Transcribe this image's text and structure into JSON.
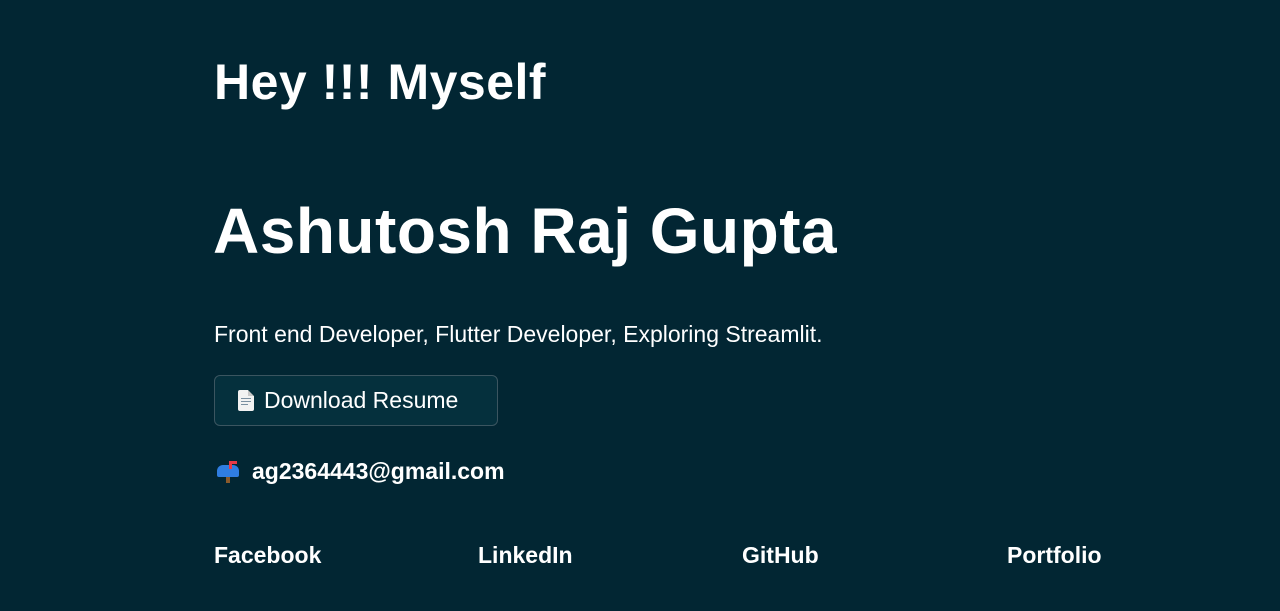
{
  "header": {
    "greeting": "Hey !!! Myself",
    "name": "Ashutosh Raj Gupta",
    "tagline": "Front end Developer, Flutter Developer, Exploring Streamlit."
  },
  "resume": {
    "icon": "document-icon",
    "label": "Download Resume"
  },
  "contact": {
    "icon": "mailbox-icon",
    "email": "ag2364443@gmail.com"
  },
  "social_links": [
    {
      "label": "Facebook"
    },
    {
      "label": "LinkedIn"
    },
    {
      "label": "GitHub"
    },
    {
      "label": "Portfolio"
    }
  ],
  "colors": {
    "background": "#022633",
    "text": "#ffffff",
    "button_border": "#3b5560"
  }
}
